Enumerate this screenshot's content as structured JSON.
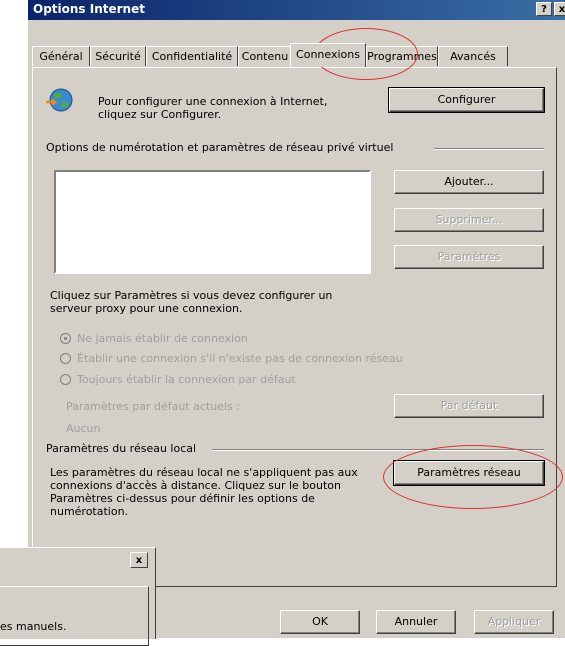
{
  "window": {
    "title": "Options Internet",
    "help_button": "?",
    "close_button": "x"
  },
  "tabs": [
    {
      "label": "Général"
    },
    {
      "label": "Sécurité"
    },
    {
      "label": "Confidentialité"
    },
    {
      "label": "Contenu"
    },
    {
      "label": "Connexions"
    },
    {
      "label": "Programmes"
    },
    {
      "label": "Avancés"
    }
  ],
  "active_tab": "Connexions",
  "setup": {
    "text": "Pour configurer une connexion à Internet, cliquez sur Configurer.",
    "button": "Configurer"
  },
  "dialup": {
    "group_label": "Options de numérotation et paramètres de réseau privé virtuel",
    "add_button": "Ajouter...",
    "remove_button": "Supprimer...",
    "settings_button": "Paramètres",
    "proxy_note": "Cliquez sur Paramètres si vous devez configurer un serveur proxy pour une connexion.",
    "radios": [
      {
        "label": "Ne jamais établir de connexion",
        "checked": true
      },
      {
        "label": "Établir une connexion s'il n'existe pas de connexion réseau",
        "checked": false
      },
      {
        "label": "Toujours établir la connexion par défaut",
        "checked": false
      }
    ],
    "current_default_label": "Paramètres par défaut actuels :",
    "current_default_value": "Aucun",
    "set_default_button": "Par défaut"
  },
  "lan": {
    "group_label": "Paramètres du réseau local",
    "text": "Les paramètres du réseau local ne s'appliquent pas aux connexions d'accès à distance. Cliquez sur le bouton Paramètres ci-dessus pour définir les options de numérotation.",
    "button": "Paramètres réseau"
  },
  "footer": {
    "ok": "OK",
    "cancel": "Annuler",
    "apply": "Appliquer"
  },
  "background_dialog": {
    "close_button": "x",
    "partial_text": "es manuels."
  },
  "annotation_color": "#e03030"
}
